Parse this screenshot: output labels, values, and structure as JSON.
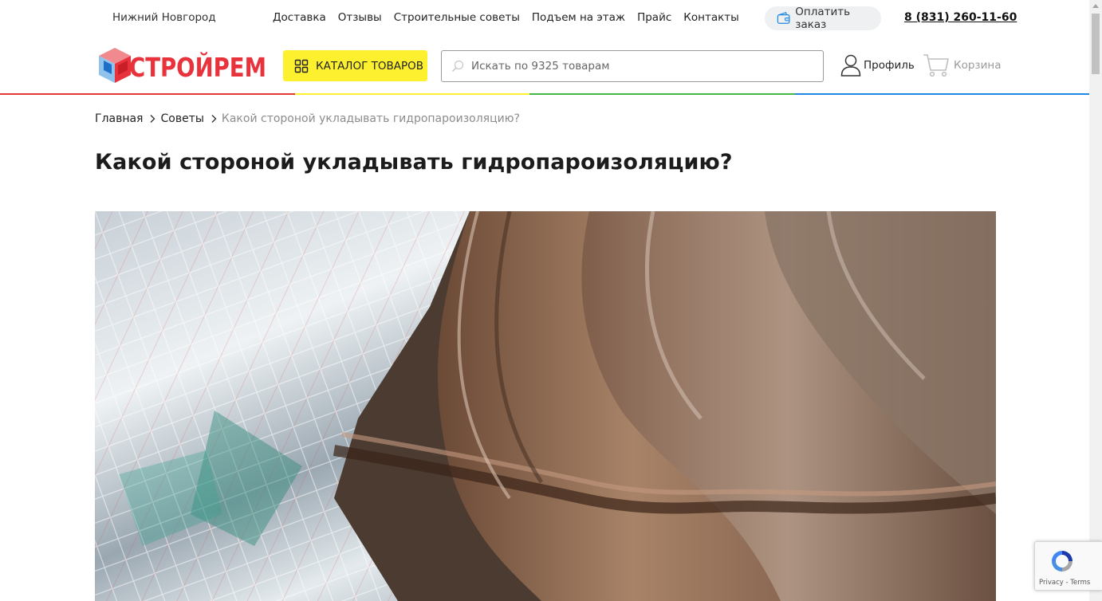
{
  "topbar": {
    "city": "Нижний Новгород",
    "nav": [
      "Доставка",
      "Отзывы",
      "Строительные советы",
      "Подъем на этаж",
      "Прайс",
      "Контакты"
    ],
    "pay_label": "Оплатить заказ",
    "phone": "8 (831) 260-11-60"
  },
  "header": {
    "logo_text": "СТРОЙРЕМ",
    "catalog_label": "КАТАЛОГ ТОВАРОВ",
    "search_placeholder": "Искать по 9325 товарам",
    "profile_label": "Профиль",
    "cart_label": "Корзина"
  },
  "colors": {
    "accent_yellow": "#fdf02f",
    "stripe": [
      "#e53935",
      "#fdf02f",
      "#43b649",
      "#1e88e5"
    ],
    "logo_red": "#e8323c"
  },
  "breadcrumb": {
    "items": [
      "Главная",
      "Советы"
    ],
    "current": "Какой стороной укладывать гидропароизоляцию?"
  },
  "page_title": "Какой стороной укладывать гидропароизоляцию?",
  "hero_image": {
    "icon": "roof-tiles-foil-photo"
  },
  "recaptcha": {
    "text": "Privacy - Terms"
  }
}
